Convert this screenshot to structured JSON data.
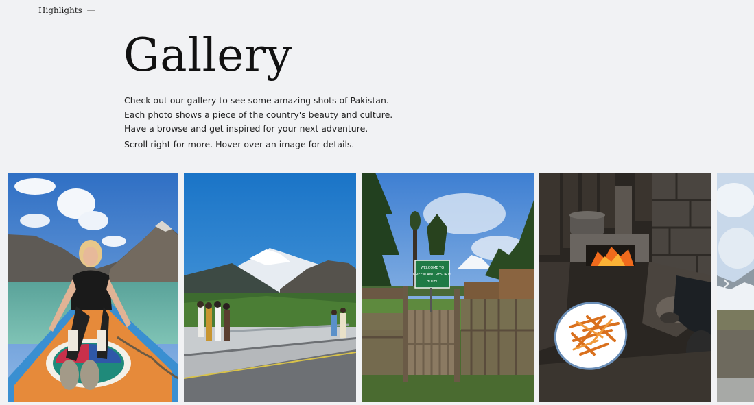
{
  "breadcrumb": {
    "label": "Highlights",
    "separator": "—"
  },
  "page": {
    "title": "Gallery",
    "description": "Check out our gallery to see some amazing shots of Pakistan. Each photo shows a piece of the country's beauty and culture. Have a browse and get inspired for your next adventure.",
    "hint": "Scroll right for more. Hover over an image for details."
  },
  "gallery": {
    "images": [
      {
        "id": "boat-lake"
      },
      {
        "id": "mountain-road"
      },
      {
        "id": "hotel-gate",
        "sign_text": "WELCOME TO GREENLAND RESORTS HOTEL"
      },
      {
        "id": "stove-fries"
      },
      {
        "id": "partial-mountain"
      }
    ],
    "next_icon": "chevron-right-icon"
  },
  "colors": {
    "background": "#f1f2f4",
    "text": "#222222"
  }
}
